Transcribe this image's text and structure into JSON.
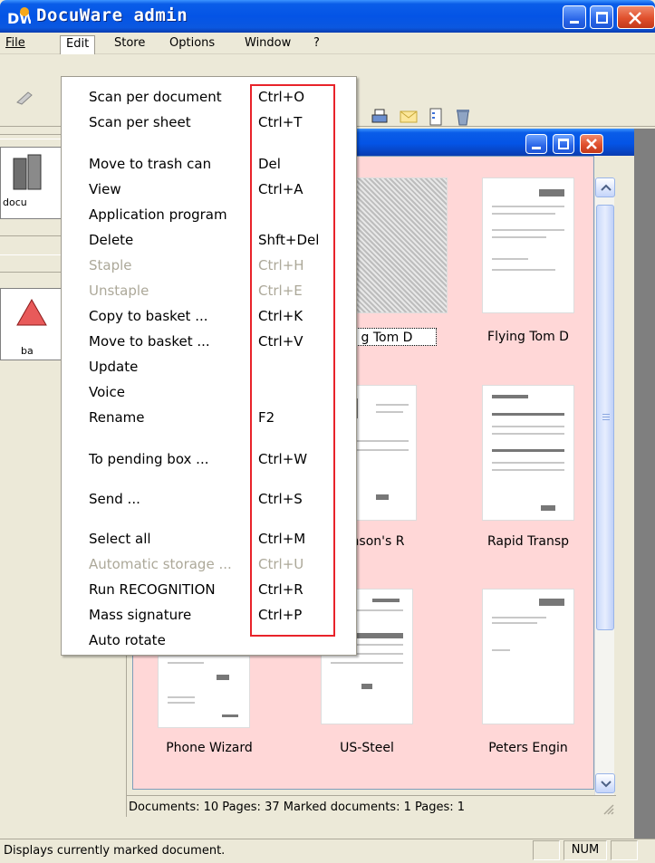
{
  "window": {
    "title": "DocuWare  admin"
  },
  "menubar": {
    "items": [
      {
        "label": "File"
      },
      {
        "label": "Edit"
      },
      {
        "label": "Store"
      },
      {
        "label": "Options"
      },
      {
        "label": "Window"
      },
      {
        "label": "?"
      }
    ]
  },
  "left_pane": {
    "labels": [
      "docu",
      "ba"
    ]
  },
  "edit_menu": {
    "items": [
      {
        "label": "Scan per document",
        "shortcut": "Ctrl+O",
        "enabled": true
      },
      {
        "label": "Scan per sheet",
        "shortcut": "Ctrl+T",
        "enabled": true
      },
      {
        "label": "Move to trash can",
        "shortcut": "Del",
        "enabled": true
      },
      {
        "label": "View",
        "shortcut": "Ctrl+A",
        "enabled": true
      },
      {
        "label": "Application program",
        "shortcut": "",
        "enabled": true
      },
      {
        "label": "Delete",
        "shortcut": "Shft+Del",
        "enabled": true
      },
      {
        "label": "Staple",
        "shortcut": "Ctrl+H",
        "enabled": false
      },
      {
        "label": "Unstaple",
        "shortcut": "Ctrl+E",
        "enabled": false
      },
      {
        "label": "Copy to basket ...",
        "shortcut": "Ctrl+K",
        "enabled": true
      },
      {
        "label": "Move to basket ...",
        "shortcut": "Ctrl+V",
        "enabled": true
      },
      {
        "label": "Update",
        "shortcut": "",
        "enabled": true
      },
      {
        "label": "Voice",
        "shortcut": "",
        "enabled": true
      },
      {
        "label": "Rename",
        "shortcut": "F2",
        "enabled": true
      },
      {
        "label": "To pending box ...",
        "shortcut": "Ctrl+W",
        "enabled": true
      },
      {
        "label": "Send ...",
        "shortcut": "Ctrl+S",
        "enabled": true
      },
      {
        "label": "Select all",
        "shortcut": "Ctrl+M",
        "enabled": true
      },
      {
        "label": "Automatic storage ...",
        "shortcut": "Ctrl+U",
        "enabled": false
      },
      {
        "label": "Run RECOGNITION",
        "shortcut": "Ctrl+R",
        "enabled": true
      },
      {
        "label": "Mass signature",
        "shortcut": "Ctrl+P",
        "enabled": true
      },
      {
        "label": "Auto rotate",
        "shortcut": "",
        "enabled": true
      }
    ]
  },
  "documents": {
    "captions": [
      "g Tom D",
      "Flying Tom D",
      "nson's R",
      "Rapid Transp",
      "Phone Wizard",
      "US-Steel",
      "Peters Engin"
    ]
  },
  "child_status": "Documents: 10  Pages: 37   Marked documents: 1  Pages: 1",
  "status": {
    "message": "Displays currently marked document.",
    "num": "NUM"
  },
  "colors": {
    "title_blue": "#0454e6",
    "content_pink": "#ffd7d7",
    "highlight_red": "#e8232a"
  }
}
